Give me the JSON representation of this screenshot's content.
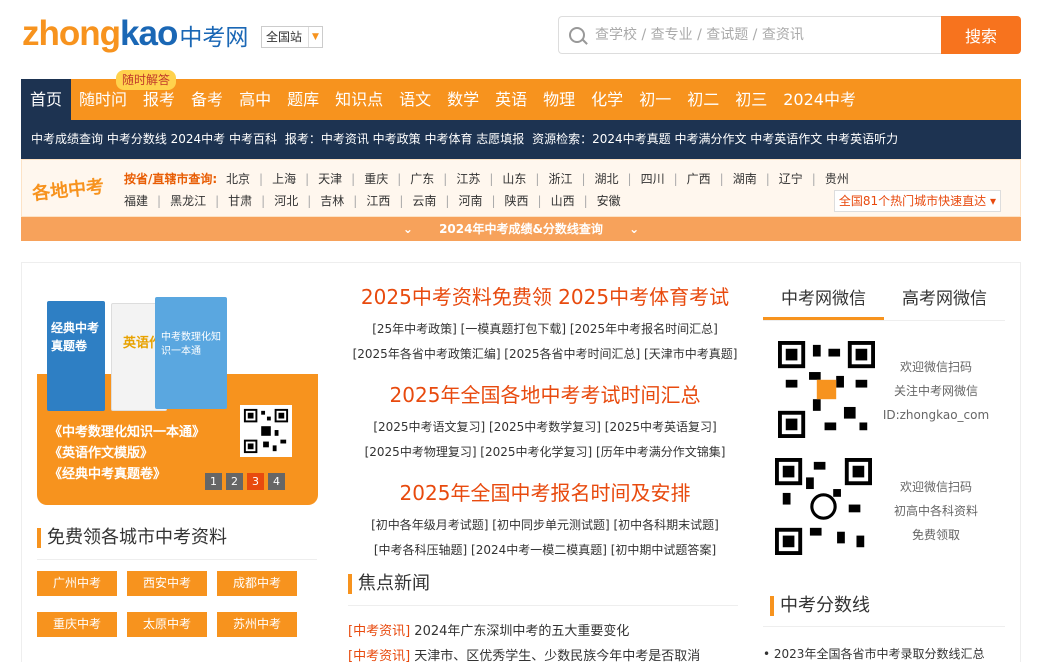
{
  "logo": {
    "part1": "zhong",
    "part2": "kao",
    "part3": "中考网"
  },
  "site_select": "全国站",
  "search": {
    "placeholder": "查学校 / 查专业 / 查试题 / 查资讯",
    "button": "搜索"
  },
  "badge": "随时解答",
  "nav": [
    "首页",
    "随时问",
    "报考",
    "备考",
    "高中",
    "题库",
    "知识点",
    "语文",
    "数学",
    "英语",
    "物理",
    "化学",
    "初一",
    "初二",
    "初三",
    "2024中考"
  ],
  "subnav": [
    "中考成绩查询 中考分数线 2024中考 中考百科",
    "报考：中考资讯 中考政策 中考体育 志愿填报",
    "资源检索：2024中考真题 中考满分作文 中考英语作文 中考英语听力"
  ],
  "region": {
    "logo": "各地中考",
    "label": "按省/直辖市查询:",
    "row1": [
      "北京",
      "上海",
      "天津",
      "重庆",
      "广东",
      "江苏",
      "山东",
      "浙江",
      "湖北",
      "四川",
      "广西",
      "湖南",
      "辽宁",
      "贵州"
    ],
    "row2": [
      "福建",
      "黑龙江",
      "甘肃",
      "河北",
      "吉林",
      "江西",
      "云南",
      "河南",
      "陕西",
      "山西",
      "安徽"
    ],
    "button": "全国81个热门城市快速直达"
  },
  "score_bar": "2024年中考成绩&分数线查询",
  "banner": {
    "lines": [
      "《中考数理化知识一本通》",
      "《英语作文模版》",
      "《经典中考真题卷》"
    ],
    "pages": [
      "1",
      "2",
      "3",
      "4"
    ],
    "book1": "经典中考真题卷",
    "book2": "英语作",
    "book3": "中考数理化知识一本通"
  },
  "cities_title": "免费领各城市中考资料",
  "cities": [
    "广州中考",
    "西安中考",
    "成都中考",
    "重庆中考",
    "太原中考",
    "苏州中考"
  ],
  "center": {
    "h1": "2025中考资料免费领 2025中考体育考试",
    "l1a": "[25年中考政策] [一模真题打包下载] [2025年中考报名时间汇总]",
    "l1b": "[2025年各省中考政策汇编] [2025各省中考时间汇总] [天津市中考真题]",
    "h2": "2025年全国各地中考考试时间汇总",
    "l2a": "[2025中考语文复习] [2025中考数学复习] [2025中考英语复习]",
    "l2b": "[2025中考物理复习] [2025中考化学复习] [历年中考满分作文锦集]",
    "h3": "2025年全国中考报名时间及安排",
    "l3a": "[初中各年级月考试题] [初中同步单元测试题] [初中各科期末试题]",
    "l3b": "[中考各科压轴题] [2024中考一模二模真题] [初中期中试题答案]"
  },
  "news": {
    "title": "焦点新闻",
    "items": [
      {
        "tag": "[中考资讯]",
        "text": "2024年广东深圳中考的五大重要变化"
      },
      {
        "tag": "[中考资讯]",
        "text": "天津市、区优秀学生、少数民族今年中考是否取消"
      }
    ]
  },
  "tabs": [
    "中考网微信",
    "高考网微信"
  ],
  "wechat1": [
    "欢迎微信扫码",
    "关注中考网微信",
    "ID:zhongkao_com"
  ],
  "wechat2": [
    "欢迎微信扫码",
    "初高中各科资料",
    "免费领取"
  ],
  "score_title": "中考分数线",
  "score_item": "2023年全国各省市中考录取分数线汇总"
}
